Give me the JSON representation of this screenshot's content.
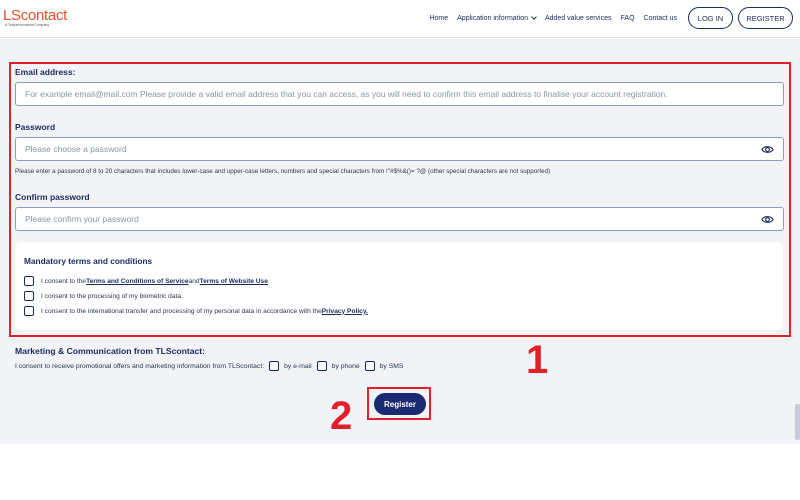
{
  "header": {
    "logo": "LScontact",
    "logo_sub": "A TeleperformanceCompany",
    "nav": [
      {
        "label": "Home"
      },
      {
        "label": "Application information"
      },
      {
        "label": "Added value services"
      },
      {
        "label": "FAQ"
      },
      {
        "label": "Contact us"
      }
    ],
    "login_label": "LOG IN",
    "register_label": "REGISTER"
  },
  "form": {
    "email_label": "Email address:",
    "email_placeholder": "For example email@mail.com Please provide a valid email address that you can access, as you will need to confirm this email address to finalise your account registration.",
    "password_label": "Password",
    "password_placeholder": "Please choose a password",
    "password_help": "Please enter a password of 8 to 20 characters that includes lower-case and upper-case letters, numbers and special characters from !\"#$%&()= ?@ (other special characters are not supported)",
    "confirm_label": "Confirm password",
    "confirm_placeholder": "Please confirm your password"
  },
  "terms": {
    "title": "Mandatory terms and conditions",
    "items": [
      {
        "prefix": "I consent to the ",
        "link1": "Terms and Conditions of Service",
        "middle": " and ",
        "link2": "Terms of Website Use",
        "suffix": "."
      },
      {
        "text": "I consent to the processing of my biometric data."
      },
      {
        "prefix": "I consent to the international transfer and processing of my personal data in accordance with the ",
        "link": "Privacy Policy."
      }
    ]
  },
  "marketing": {
    "title": "Marketing & Communication from TLScontact:",
    "text": "I consent to receive promotional offers and marketing information from TLScontact:",
    "options": [
      "by e-mail",
      "by phone",
      "by SMS"
    ]
  },
  "register_button": "Register",
  "annotations": {
    "one": "1",
    "two": "2"
  },
  "colors": {
    "brand": "#e0522b",
    "navy": "#1b2a5c",
    "highlight": "#e0202a",
    "button": "#1b2a70"
  },
  "icons": {
    "eye": "eye-icon",
    "chevron": "chevron-down-icon"
  }
}
